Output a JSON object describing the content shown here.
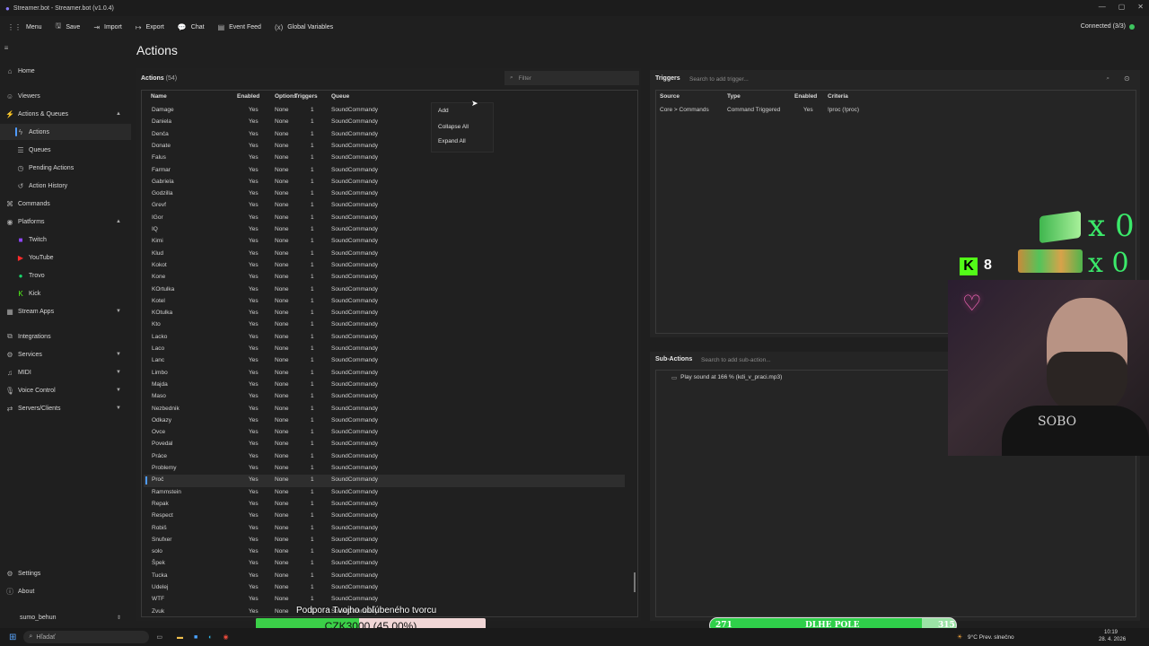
{
  "window": {
    "title": "Streamer.bot - Streamer.bot (v1.0.4)",
    "controls": [
      "—",
      "▢",
      "✕"
    ]
  },
  "toolbar": [
    {
      "icon": "grid-icon",
      "glyph": "⋮⋮",
      "label": "Menu"
    },
    {
      "icon": "save-icon",
      "glyph": "🖫",
      "label": "Save"
    },
    {
      "icon": "import-icon",
      "glyph": "⇥",
      "label": "Import"
    },
    {
      "icon": "export-icon",
      "glyph": "↦",
      "label": "Export"
    },
    {
      "icon": "chat-icon",
      "glyph": "💬",
      "label": "Chat"
    },
    {
      "icon": "event-feed-icon",
      "glyph": "▤",
      "label": "Event Feed"
    },
    {
      "icon": "variables-icon",
      "glyph": "(x)",
      "label": "Global Variables"
    }
  ],
  "connection": {
    "label": "Connected (3/3)",
    "color": "#3ec45f"
  },
  "sidebar": {
    "hamburger": "≡",
    "items": [
      {
        "label": "Home",
        "icon": "home-icon",
        "glyph": "⌂"
      },
      {
        "label": "Viewers",
        "icon": "viewers-icon",
        "glyph": "☺"
      },
      {
        "label": "Actions & Queues",
        "icon": "actions-icon",
        "glyph": "⚡",
        "chev": "▲"
      },
      {
        "label": "Actions",
        "icon": "bolt-icon",
        "glyph": "ϟ",
        "sub": true,
        "active": true
      },
      {
        "label": "Queues",
        "icon": "queue-icon",
        "glyph": "☰",
        "sub": true
      },
      {
        "label": "Pending Actions",
        "icon": "pending-icon",
        "glyph": "◷",
        "sub": true
      },
      {
        "label": "Action History",
        "icon": "history-icon",
        "glyph": "↺",
        "sub": true
      },
      {
        "label": "Commands",
        "icon": "commands-icon",
        "glyph": "⌘"
      },
      {
        "label": "Platforms",
        "icon": "platforms-icon",
        "glyph": "◉",
        "chev": "▲"
      },
      {
        "label": "Twitch",
        "icon": "twitch-icon",
        "glyph": "■",
        "sub": true,
        "color": "#9146ff"
      },
      {
        "label": "YouTube",
        "icon": "youtube-icon",
        "glyph": "▶",
        "sub": true,
        "color": "#ff2b2b"
      },
      {
        "label": "Trovo",
        "icon": "trovo-icon",
        "glyph": "●",
        "sub": true,
        "color": "#19d66b"
      },
      {
        "label": "Kick",
        "icon": "kick-icon",
        "glyph": "K",
        "sub": true,
        "color": "#53fc18"
      },
      {
        "label": "Stream Apps",
        "icon": "apps-icon",
        "glyph": "▦",
        "chev": "▼"
      },
      {
        "label": "Integrations",
        "icon": "integrations-icon",
        "glyph": "⧉"
      },
      {
        "label": "Services",
        "icon": "services-icon",
        "glyph": "⚙",
        "chev": "▼"
      },
      {
        "label": "MIDI",
        "icon": "midi-icon",
        "glyph": "♫",
        "chev": "▼"
      },
      {
        "label": "Voice Control",
        "icon": "mic-icon",
        "glyph": "🎙",
        "chev": "▼"
      },
      {
        "label": "Servers/Clients",
        "icon": "server-icon",
        "glyph": "⇄",
        "chev": "▼"
      }
    ],
    "bottom": [
      {
        "label": "Settings",
        "icon": "settings-icon",
        "glyph": "⚙"
      },
      {
        "label": "About",
        "icon": "info-icon",
        "glyph": "ⓘ"
      }
    ],
    "user": "sumo_behun",
    "user_chev": "⇕"
  },
  "page": {
    "title": "Actions"
  },
  "actions": {
    "header": "Actions",
    "count": "(54)",
    "filter_placeholder": "Filter",
    "columns": [
      "Name",
      "Enabled",
      "Options",
      "Triggers",
      "Queue"
    ],
    "rows": [
      [
        "Damage",
        "Yes",
        "None",
        "1",
        "SoundCommandy"
      ],
      [
        "Daniela",
        "Yes",
        "None",
        "1",
        "SoundCommandy"
      ],
      [
        "Denča",
        "Yes",
        "None",
        "1",
        "SoundCommandy"
      ],
      [
        "Donate",
        "Yes",
        "None",
        "1",
        "SoundCommandy"
      ],
      [
        "Falus",
        "Yes",
        "None",
        "1",
        "SoundCommandy"
      ],
      [
        "Farmar",
        "Yes",
        "None",
        "1",
        "SoundCommandy"
      ],
      [
        "Gabriela",
        "Yes",
        "None",
        "1",
        "SoundCommandy"
      ],
      [
        "Godzilla",
        "Yes",
        "None",
        "1",
        "SoundCommandy"
      ],
      [
        "Grevf",
        "Yes",
        "None",
        "1",
        "SoundCommandy"
      ],
      [
        "IGor",
        "Yes",
        "None",
        "1",
        "SoundCommandy"
      ],
      [
        "IQ",
        "Yes",
        "None",
        "1",
        "SoundCommandy"
      ],
      [
        "Kimi",
        "Yes",
        "None",
        "1",
        "SoundCommandy"
      ],
      [
        "Klud",
        "Yes",
        "None",
        "1",
        "SoundCommandy"
      ],
      [
        "Kokot",
        "Yes",
        "None",
        "1",
        "SoundCommandy"
      ],
      [
        "Kone",
        "Yes",
        "None",
        "1",
        "SoundCommandy"
      ],
      [
        "KOrtulka",
        "Yes",
        "None",
        "1",
        "SoundCommandy"
      ],
      [
        "Kotel",
        "Yes",
        "None",
        "1",
        "SoundCommandy"
      ],
      [
        "KOtulka",
        "Yes",
        "None",
        "1",
        "SoundCommandy"
      ],
      [
        "Kto",
        "Yes",
        "None",
        "1",
        "SoundCommandy"
      ],
      [
        "Lacko",
        "Yes",
        "None",
        "1",
        "SoundCommandy"
      ],
      [
        "Laco",
        "Yes",
        "None",
        "1",
        "SoundCommandy"
      ],
      [
        "Lanc",
        "Yes",
        "None",
        "1",
        "SoundCommandy"
      ],
      [
        "Limbo",
        "Yes",
        "None",
        "1",
        "SoundCommandy"
      ],
      [
        "Majda",
        "Yes",
        "None",
        "1",
        "SoundCommandy"
      ],
      [
        "Maso",
        "Yes",
        "None",
        "1",
        "SoundCommandy"
      ],
      [
        "Nezbednik",
        "Yes",
        "None",
        "1",
        "SoundCommandy"
      ],
      [
        "Odkazy",
        "Yes",
        "None",
        "1",
        "SoundCommandy"
      ],
      [
        "Ovce",
        "Yes",
        "None",
        "1",
        "SoundCommandy"
      ],
      [
        "Povedal",
        "Yes",
        "None",
        "1",
        "SoundCommandy"
      ],
      [
        "Práce",
        "Yes",
        "None",
        "1",
        "SoundCommandy"
      ],
      [
        "Problemy",
        "Yes",
        "None",
        "1",
        "SoundCommandy"
      ],
      [
        "Proč",
        "Yes",
        "None",
        "1",
        "SoundCommandy"
      ],
      [
        "Rammstein",
        "Yes",
        "None",
        "1",
        "SoundCommandy"
      ],
      [
        "Repak",
        "Yes",
        "None",
        "1",
        "SoundCommandy"
      ],
      [
        "Respect",
        "Yes",
        "None",
        "1",
        "SoundCommandy"
      ],
      [
        "Robiš",
        "Yes",
        "None",
        "1",
        "SoundCommandy"
      ],
      [
        "Snufxer",
        "Yes",
        "None",
        "1",
        "SoundCommandy"
      ],
      [
        "solo",
        "Yes",
        "None",
        "1",
        "SoundCommandy"
      ],
      [
        "Špek",
        "Yes",
        "None",
        "1",
        "SoundCommandy"
      ],
      [
        "Tucka",
        "Yes",
        "None",
        "1",
        "SoundCommandy"
      ],
      [
        "Udelej",
        "Yes",
        "None",
        "1",
        "SoundCommandy"
      ],
      [
        "WTF",
        "Yes",
        "None",
        "1",
        "SoundCommandy"
      ],
      [
        "Zvuk",
        "Yes",
        "None",
        "1",
        "SoundCommandy"
      ]
    ],
    "selected_index": 31
  },
  "context_menu": [
    "Add",
    "Collapse All",
    "Expand All"
  ],
  "triggers": {
    "header": "Triggers",
    "search_placeholder": "Search to add trigger...",
    "columns": [
      "Source",
      "Type",
      "Enabled",
      "Criteria"
    ],
    "rows": [
      [
        "Core > Commands",
        "Command Triggered",
        "Yes",
        "!proc (!proc)"
      ]
    ]
  },
  "subactions": {
    "header": "Sub-Actions",
    "search_placeholder": "Search to add sub-action...",
    "items": [
      "Play sound at 166 % (kdi_v_praci.mp3)"
    ]
  },
  "overlay": {
    "donate_text": "Podpora Tvojho obľúbeného tvorcu",
    "goal_text": "CZK3000 (45.00%)",
    "goal_progress": 0.45,
    "bar2_left": "271",
    "bar2_label": "DLHE POLE",
    "bar2_right": "315",
    "bar2_progress": 0.86,
    "counter1": "x 0",
    "counter2": "x 0",
    "kick_count": "8",
    "kick_logo": "K",
    "cam_shirt": "SOBO"
  },
  "taskbar": {
    "search_placeholder": "Hľadať",
    "weather": "9°C  Prev. slnečno",
    "time": "10:19",
    "date": "28. 4. 2026"
  }
}
